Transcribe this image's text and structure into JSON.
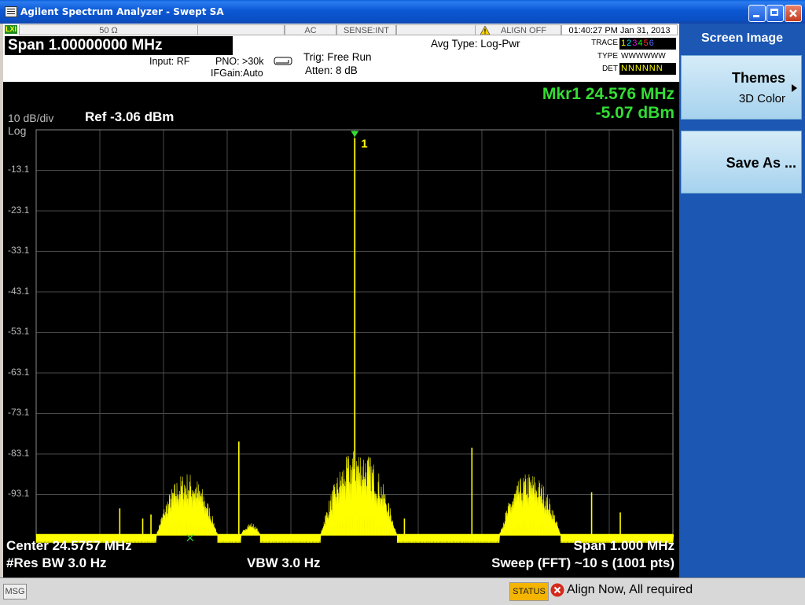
{
  "window": {
    "title": "Agilent Spectrum Analyzer - Swept SA"
  },
  "status_bar": {
    "lxi": "LXI",
    "impedance": "50 Ω",
    "coupling": "AC",
    "sense": "SENSE:INT",
    "align": "ALIGN OFF",
    "datetime": "01:40:27 PM Jan 31, 2013"
  },
  "measurement": {
    "span_label": "Span  1.00000000 MHz",
    "input": "Input: RF",
    "pno": "PNO: >30k",
    "ifgain": "IFGain:Auto",
    "trig": "Trig: Free Run",
    "atten": "Atten: 8 dB",
    "avg_type": "Avg Type: Log-Pwr",
    "trace_label": "TRACE",
    "type_label": "TYPE",
    "det_label": "DET",
    "trace_numbers": [
      "1",
      "2",
      "3",
      "4",
      "5",
      "6"
    ],
    "trace_colors": [
      "#ffff00",
      "#00e5ff",
      "#ff00ff",
      "#00ff00",
      "#ff3030",
      "#5a6bff"
    ],
    "trace_type": "WWWWWW",
    "trace_det": "NNNNNN"
  },
  "screen": {
    "scale": "10 dB/div",
    "log": "Log",
    "ref": "Ref -3.06 dBm",
    "marker_freq": "Mkr1 24.576 MHz",
    "marker_amp": "-5.07 dBm",
    "marker_label": "1",
    "y_labels": [
      "-13.1",
      "-23.1",
      "-33.1",
      "-43.1",
      "-53.1",
      "-63.1",
      "-73.1",
      "-83.1",
      "-93.1"
    ],
    "center": "Center 24.5757 MHz",
    "span": "Span 1.000 MHz",
    "rbw": "#Res BW 3.0 Hz",
    "vbw": "VBW 3.0 Hz",
    "sweep": "Sweep (FFT)  ~10 s (1001 pts)",
    "trace_color": "#ffff00",
    "marker_color": "#33dd33"
  },
  "softkeys": {
    "header": "Screen Image",
    "themes_title": "Themes",
    "themes_sub": "3D Color",
    "save_as": "Save As ..."
  },
  "message_bar": {
    "msg": "MSG",
    "status": "STATUS",
    "status_text": "Align Now, All required"
  },
  "chart_data": {
    "type": "line",
    "title": "",
    "xlabel": "",
    "ylabel": "",
    "x_range_mhz": [
      24.0757,
      25.0757
    ],
    "ylim": [
      -103.06,
      -3.06
    ],
    "y_ticks": [
      -13.06,
      -23.06,
      -33.06,
      -43.06,
      -53.06,
      -63.06,
      -73.06,
      -83.06,
      -93.06
    ],
    "grid": true,
    "noise_floor_dbm": -103,
    "series": [
      {
        "clusters": [
          {
            "center_mhz": 24.3125,
            "peak_dbm": -87.5,
            "half_width_mhz": 0.048
          },
          {
            "center_mhz": 24.582,
            "peak_dbm": -81.5,
            "half_width_mhz": 0.06
          },
          {
            "center_mhz": 24.851,
            "peak_dbm": -87.5,
            "half_width_mhz": 0.048
          },
          {
            "center_mhz": 24.4125,
            "peak_dbm": -100.0,
            "half_width_mhz": 0.015
          }
        ],
        "spurs": [
          {
            "mhz": 24.207,
            "dbm": -96.5
          },
          {
            "mhz": 24.394,
            "dbm": -80.0
          },
          {
            "mhz": 24.654,
            "dbm": -99.0
          },
          {
            "mhz": 24.76,
            "dbm": -81.5
          },
          {
            "mhz": 24.948,
            "dbm": -92.5
          },
          {
            "mhz": 24.993,
            "dbm": -97.5
          },
          {
            "mhz": 24.243,
            "dbm": -99.0
          },
          {
            "mhz": 24.256,
            "dbm": -98.0
          }
        ],
        "carrier": {
          "mhz": 24.576,
          "dbm": -5.07
        }
      }
    ]
  }
}
